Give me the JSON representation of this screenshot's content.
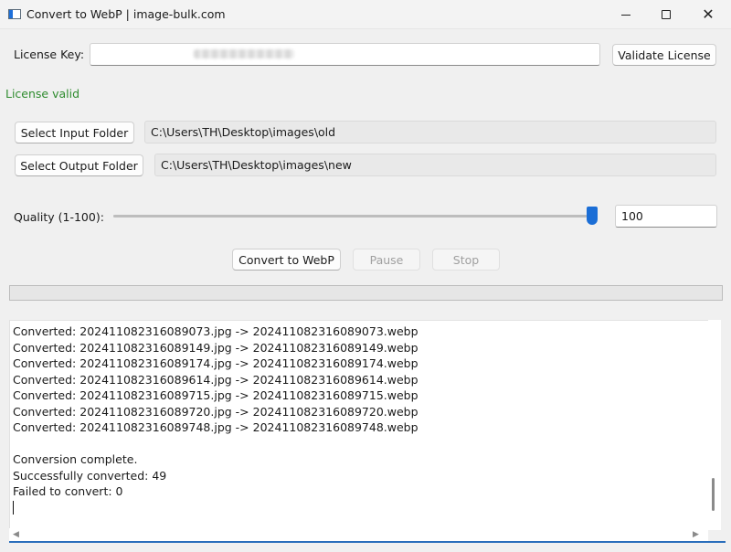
{
  "window": {
    "title": "Convert to WebP | image-bulk.com",
    "controls": {
      "minimize": "—",
      "maximize": "□",
      "close": "✕"
    }
  },
  "license": {
    "label": "License Key:",
    "value": "",
    "validate_button": "Validate License",
    "status": "License valid",
    "status_color": "#2e8b2e"
  },
  "folders": {
    "input_button": "Select Input Folder",
    "input_path": "C:\\Users\\TH\\Desktop\\images\\old",
    "output_button": "Select Output Folder",
    "output_path": "C:\\Users\\TH\\Desktop\\images\\new"
  },
  "quality": {
    "label": "Quality (1-100):",
    "value": "100",
    "slider_fraction": 1.0,
    "accent_color": "#1b6ed6"
  },
  "actions": {
    "convert": "Convert to WebP",
    "pause": "Pause",
    "stop": "Stop"
  },
  "progress": {
    "value": 0
  },
  "log": {
    "lines": [
      "Converted: 202411082316089073.jpg -> 202411082316089073.webp",
      "Converted: 202411082316089149.jpg -> 202411082316089149.webp",
      "Converted: 202411082316089174.jpg -> 202411082316089174.webp",
      "Converted: 202411082316089614.jpg -> 202411082316089614.webp",
      "Converted: 202411082316089715.jpg -> 202411082316089715.webp",
      "Converted: 202411082316089720.jpg -> 202411082316089720.webp",
      "Converted: 202411082316089748.jpg -> 202411082316089748.webp",
      "",
      "Conversion complete.",
      "Successfully converted: 49",
      "Failed to convert: 0"
    ]
  },
  "icons": {
    "app": "app-window-icon",
    "scroll_left": "◀",
    "scroll_right": "▶"
  }
}
